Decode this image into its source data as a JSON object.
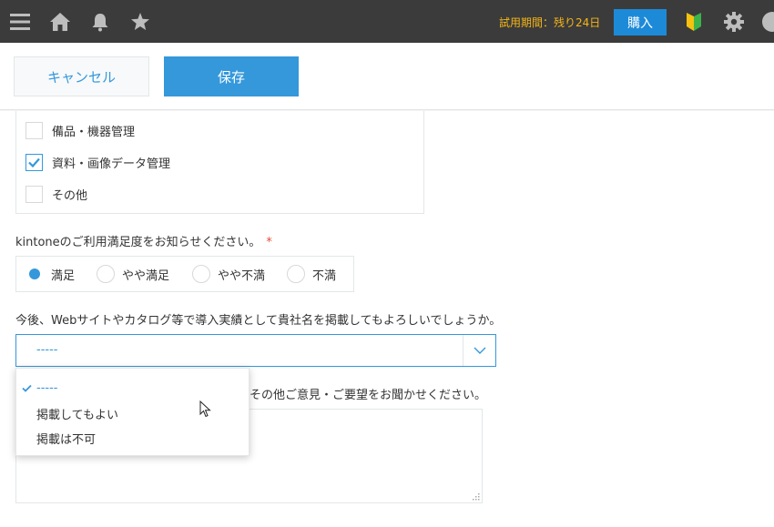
{
  "topbar": {
    "icons": [
      "menu-icon",
      "home-icon",
      "bell-icon",
      "star-icon",
      "beginner-mark-icon",
      "gear-icon",
      "help-icon"
    ],
    "trial_text": "試用期間：残り24日",
    "buy_label": "購入",
    "colors": {
      "background": "#3b3b3b",
      "trial": "#f5b617",
      "buy": "#1d8ad8"
    }
  },
  "actions": {
    "cancel_label": "キャンセル",
    "save_label": "保存"
  },
  "form": {
    "checkboxes": [
      {
        "label": "備品・機器管理",
        "checked": false
      },
      {
        "label": "資料・画像データ管理",
        "checked": true
      },
      {
        "label": "その他",
        "checked": false
      }
    ],
    "satisfaction": {
      "label": "kintoneのご利用満足度をお知らせください。",
      "required_mark": "*",
      "options": [
        "満足",
        "やや満足",
        "やや不満",
        "不満"
      ],
      "selected": "満足"
    },
    "publish": {
      "label": "今後、Webサイトやカタログ等で導入実績として貴社名を掲載してもよろしいでしょうか。",
      "value": "-----",
      "options": [
        "-----",
        "掲載してもよい",
        "掲載は不可"
      ],
      "selected_index": 0
    },
    "opinion": {
      "label_visible": "その他ご意見・ご要望をお聞かせください。",
      "value": ""
    }
  },
  "accent_color": "#3498db"
}
